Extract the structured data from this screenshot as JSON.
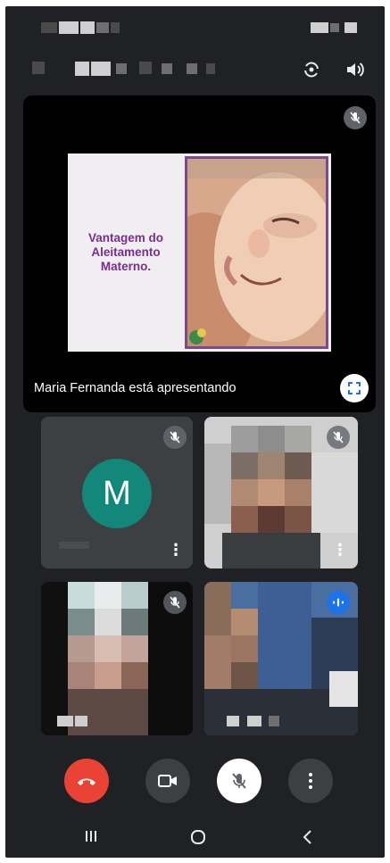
{
  "presentation": {
    "slide_title": "Vantagem do Aleitamento Materno.",
    "presenting_label": "Maria Fernanda está apresentando"
  },
  "participants": [
    {
      "initial": "M",
      "avatar_color": "#12877a"
    }
  ],
  "colors": {
    "background": "#202124",
    "tile": "#3c4043",
    "end_call": "#ea4335",
    "speaking": "#1a73e8",
    "slide_accent": "#7b2d8e"
  },
  "icons": {
    "end_call": "phone-hangup-icon",
    "camera": "video-camera-icon",
    "microphone": "mic-off-icon",
    "more": "more-vert-icon",
    "speaker": "volume-icon",
    "switch_camera": "camera-switch-icon",
    "fullscreen": "fullscreen-icon"
  }
}
